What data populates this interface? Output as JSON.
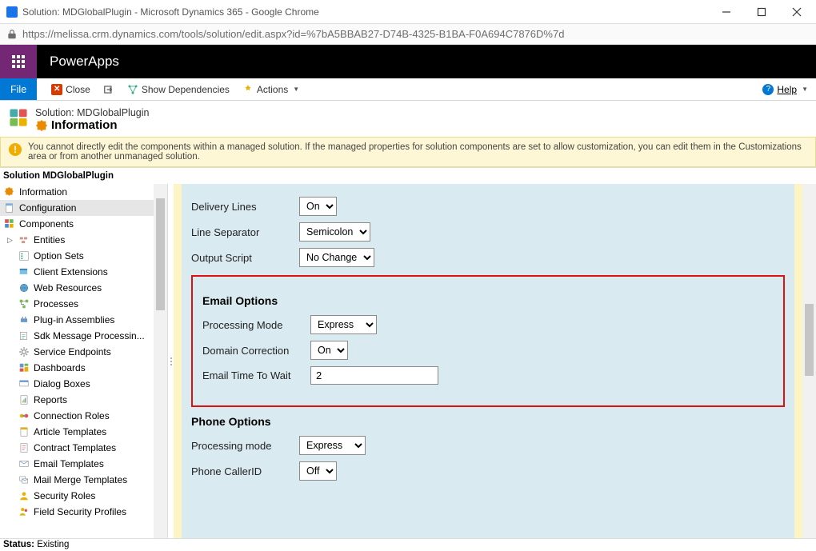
{
  "window": {
    "title": "Solution: MDGlobalPlugin - Microsoft Dynamics 365 - Google Chrome",
    "url": "https://melissa.crm.dynamics.com/tools/solution/edit.aspx?id=%7bA5BBAB27-D74B-4325-B1BA-F0A694C7876D%7d"
  },
  "header": {
    "brand": "PowerApps"
  },
  "toolbar": {
    "file": "File",
    "close": "Close",
    "show_dependencies": "Show Dependencies",
    "actions": "Actions",
    "help": "Help"
  },
  "solution": {
    "prefix": "Solution:",
    "name": "MDGlobalPlugin",
    "section": "Information"
  },
  "warning": "You cannot directly edit the components within a managed solution. If the managed properties for solution components are set to allow customization, you can edit them in the Customizations area or from another unmanaged solution.",
  "nav": {
    "title": "Solution MDGlobalPlugin",
    "information": "Information",
    "configuration": "Configuration",
    "components": "Components",
    "entities": "Entities",
    "option_sets": "Option Sets",
    "client_extensions": "Client Extensions",
    "web_resources": "Web Resources",
    "processes": "Processes",
    "plugin_assemblies": "Plug-in Assemblies",
    "sdk_msg": "Sdk Message Processin...",
    "service_endpoints": "Service Endpoints",
    "dashboards": "Dashboards",
    "dialog_boxes": "Dialog Boxes",
    "reports": "Reports",
    "connection_roles": "Connection Roles",
    "article_templates": "Article Templates",
    "contract_templates": "Contract Templates",
    "email_templates": "Email Templates",
    "mail_merge_templates": "Mail Merge Templates",
    "security_roles": "Security Roles",
    "field_security_profiles": "Field Security Profiles"
  },
  "form": {
    "center": {
      "delivery_lines": {
        "label": "Delivery Lines",
        "value": "On"
      },
      "line_separator": {
        "label": "Line Separator",
        "value": "Semicolon"
      },
      "output_script": {
        "label": "Output Script",
        "value": "No Change"
      }
    },
    "email": {
      "title": "Email Options",
      "processing_mode": {
        "label": "Processing Mode",
        "value": "Express"
      },
      "domain_correction": {
        "label": "Domain Correction",
        "value": "On"
      },
      "time_to_wait": {
        "label": "Email Time To Wait",
        "value": "2"
      }
    },
    "phone": {
      "title": "Phone Options",
      "processing_mode": {
        "label": "Processing mode",
        "value": "Express"
      },
      "caller_id": {
        "label": "Phone CallerID",
        "value": "Off"
      }
    }
  },
  "status": {
    "label": "Status:",
    "value": "Existing"
  }
}
